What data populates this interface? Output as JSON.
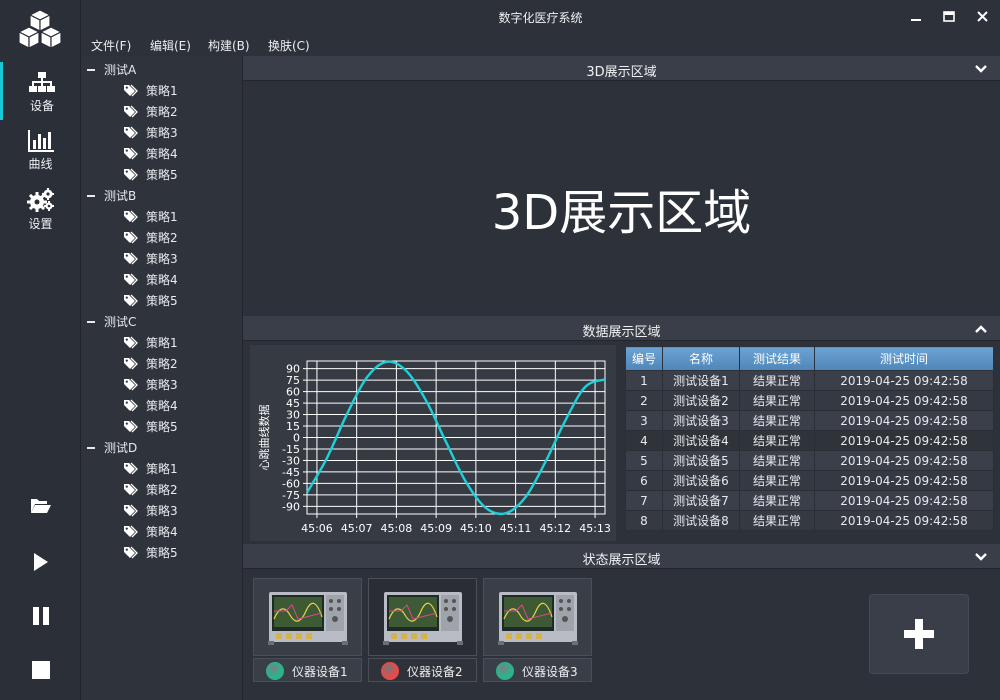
{
  "window": {
    "title": "数字化医疗系统"
  },
  "menubar": {
    "items": [
      "文件(F)",
      "编辑(E)",
      "构建(B)",
      "换肤(C)"
    ]
  },
  "nav": {
    "items": [
      {
        "label": "设备",
        "icon": "sitemap-icon",
        "active": true
      },
      {
        "label": "曲线",
        "icon": "bar-chart-icon",
        "active": false
      },
      {
        "label": "设置",
        "icon": "gears-icon",
        "active": false
      }
    ],
    "tools": [
      "folder-open-icon",
      "play-icon",
      "pause-icon",
      "stop-icon"
    ]
  },
  "tree": {
    "groups": [
      {
        "label": "测试A",
        "children": [
          "策略1",
          "策略2",
          "策略3",
          "策略4",
          "策略5"
        ]
      },
      {
        "label": "测试B",
        "children": [
          "策略1",
          "策略2",
          "策略3",
          "策略4",
          "策略5"
        ]
      },
      {
        "label": "测试C",
        "children": [
          "策略1",
          "策略2",
          "策略3",
          "策略4",
          "策略5"
        ]
      },
      {
        "label": "测试D",
        "children": [
          "策略1",
          "策略2",
          "策略3",
          "策略4",
          "策略5"
        ]
      }
    ]
  },
  "panels": {
    "view3d": {
      "title": "3D展示区域",
      "content": "3D展示区域"
    },
    "data": {
      "title": "数据展示区域"
    },
    "state": {
      "title": "状态展示区域"
    }
  },
  "chart_data": {
    "type": "line",
    "ylabel": "心跳曲线数据",
    "xlabel": "",
    "ylim": [
      -100,
      100
    ],
    "yticks": [
      90,
      75,
      60,
      45,
      30,
      15,
      0,
      -15,
      -30,
      -45,
      -60,
      -75,
      -90
    ],
    "xticks": [
      "45:06",
      "45:07",
      "45:08",
      "45:09",
      "45:10",
      "45:11",
      "45:12",
      "45:13"
    ],
    "xlim": [
      "45:05.75",
      "45:13.25"
    ],
    "series": [
      {
        "color": "#1fd0d8",
        "x": [
          "45:05.75",
          "45:06.25",
          "45:06.75",
          "45:07.25",
          "45:07.75",
          "45:08.25",
          "45:08.75",
          "45:09.25",
          "45:09.75",
          "45:10.25",
          "45:10.75",
          "45:11.25",
          "45:11.75",
          "45:12.25",
          "45:12.75",
          "45:13.25"
        ],
        "values": [
          -72,
          -27,
          30,
          78,
          99,
          87,
          48,
          -6,
          -58,
          -92,
          -99,
          -78,
          -32,
          22,
          66,
          76
        ]
      }
    ],
    "grid": true
  },
  "table": {
    "headers": [
      "编号",
      "名称",
      "测试结果",
      "测试时间"
    ],
    "rows": [
      [
        "1",
        "测试设备1",
        "结果正常",
        "2019-04-25 09:42:58"
      ],
      [
        "2",
        "测试设备2",
        "结果正常",
        "2019-04-25 09:42:58"
      ],
      [
        "3",
        "测试设备3",
        "结果正常",
        "2019-04-25 09:42:58"
      ],
      [
        "4",
        "测试设备4",
        "结果正常",
        "2019-04-25 09:42:58"
      ],
      [
        "5",
        "测试设备5",
        "结果正常",
        "2019-04-25 09:42:58"
      ],
      [
        "6",
        "测试设备6",
        "结果正常",
        "2019-04-25 09:42:58"
      ],
      [
        "7",
        "测试设备7",
        "结果正常",
        "2019-04-25 09:42:58"
      ],
      [
        "8",
        "测试设备8",
        "结果正常",
        "2019-04-25 09:42:58"
      ]
    ]
  },
  "devices": [
    {
      "name": "仪器设备1",
      "status_color": "#2bb38a",
      "selected": false
    },
    {
      "name": "仪器设备2",
      "status_color": "#e34c4c",
      "selected": true
    },
    {
      "name": "仪器设备3",
      "status_color": "#2bb38a",
      "selected": false
    }
  ],
  "colors": {
    "accent": "#17c8d8",
    "header": "#5d93c4"
  }
}
